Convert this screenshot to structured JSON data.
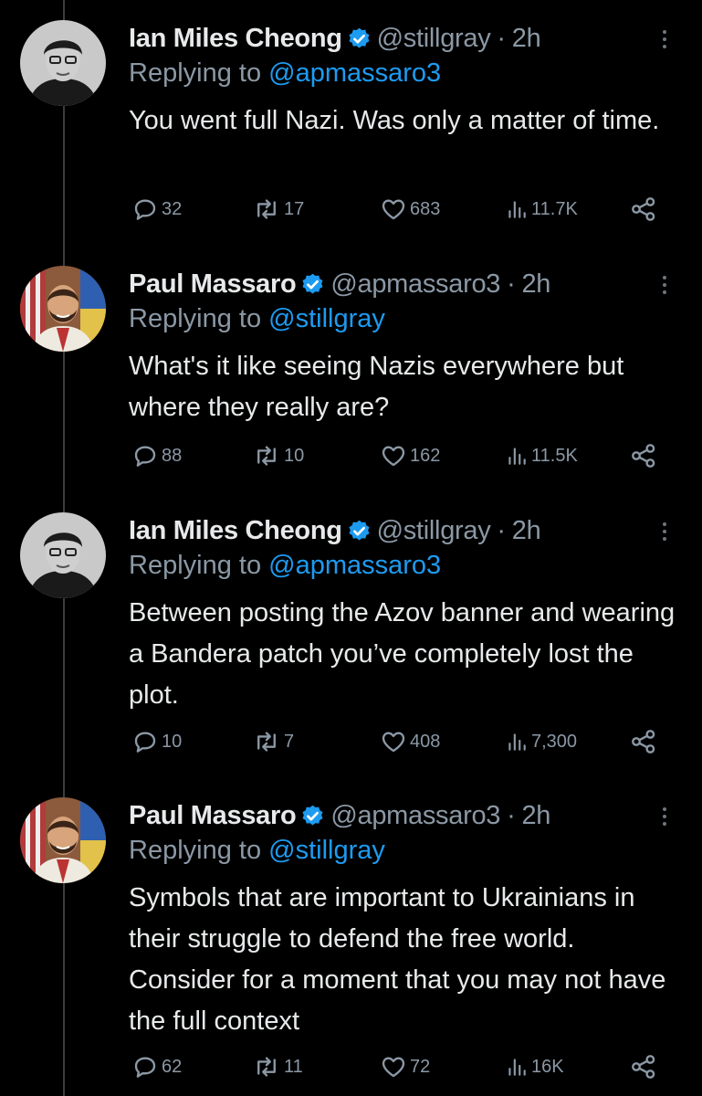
{
  "colors": {
    "background": "#000000",
    "text": "#e7e9ea",
    "muted": "#8b98a5",
    "link": "#1d9bf0",
    "verified": "#1d9bf0",
    "thread_line": "#3a3d41"
  },
  "icons": {
    "verified": "verified-badge-icon",
    "more": "more-vertical-icon",
    "reply": "reply-bubble-icon",
    "retweet": "retweet-icon",
    "like": "heart-icon",
    "views": "views-bar-icon",
    "share": "share-icon"
  },
  "tweets": [
    {
      "author": "Ian Miles Cheong",
      "handle": "@stillgray",
      "separator": "·",
      "time": "2h",
      "replying_label": "Replying to",
      "replying_to": "@apmassaro3",
      "text": "You went full Nazi. Was only a matter of time.",
      "replies": "32",
      "retweets": "17",
      "likes": "683",
      "views": "11.7K"
    },
    {
      "author": "Paul Massaro",
      "handle": "@apmassaro3",
      "separator": "·",
      "time": "2h",
      "replying_label": "Replying to",
      "replying_to": "@stillgray",
      "text": "What's it like seeing Nazis everywhere but where they really are?",
      "replies": "88",
      "retweets": "10",
      "likes": "162",
      "views": "11.5K"
    },
    {
      "author": "Ian Miles Cheong",
      "handle": "@stillgray",
      "separator": "·",
      "time": "2h",
      "replying_label": "Replying to",
      "replying_to": "@apmassaro3",
      "text": "Between posting the Azov banner and wearing a Bandera patch you’ve completely lost the plot.",
      "replies": "10",
      "retweets": "7",
      "likes": "408",
      "views": "7,300"
    },
    {
      "author": "Paul Massaro",
      "handle": "@apmassaro3",
      "separator": "·",
      "time": "2h",
      "replying_label": "Replying to",
      "replying_to": "@stillgray",
      "text": "Symbols that are important to Ukrainians in their struggle to defend the free world. Consider for a moment that you may not have the full context",
      "replies": "62",
      "retweets": "11",
      "likes": "72",
      "views": "16K"
    }
  ]
}
